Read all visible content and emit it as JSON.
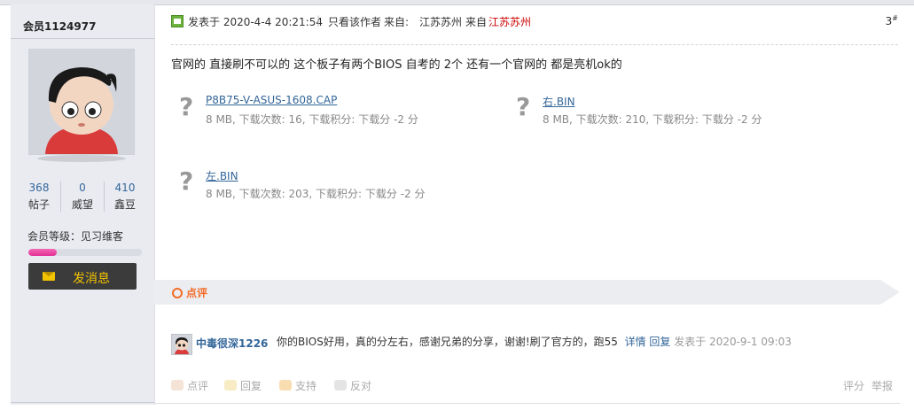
{
  "sidebar": {
    "username": "会员1124977",
    "stats": [
      {
        "value": "368",
        "label": "帖子"
      },
      {
        "value": "0",
        "label": "威望"
      },
      {
        "value": "410",
        "label": "鑫豆"
      }
    ],
    "level_label": "会员等级：见习维客",
    "level_progress_percent": 25,
    "message_button": "发消息"
  },
  "post": {
    "posted_label": "发表于 2020-4-4 20:21:54",
    "author_only": "只看该作者",
    "from_label": "来自:",
    "from_location": "江苏苏州",
    "from_label2": "来自",
    "from_location_red": "江苏苏州",
    "floor_number": "3",
    "floor_suffix": "#",
    "content": "官网的 直接刷不可以的 这个板子有两个BIOS 自考的 2个  还有一个官网的 都是亮机ok的",
    "attachments": [
      {
        "name": "P8B75-V-ASUS-1608.CAP",
        "meta": "8 MB, 下载次数: 16, 下载积分: 下载分 -2 分"
      },
      {
        "name": "右.BIN",
        "meta": "8 MB, 下载次数: 210, 下载积分: 下载分 -2 分"
      },
      {
        "name": "左.BIN",
        "meta": "8 MB, 下载次数: 203, 下载积分: 下载分 -2 分"
      }
    ]
  },
  "rating": {
    "title": "点评"
  },
  "comment": {
    "user": "中毒很深1226",
    "text": "你的BIOS好用，真的分左右，感谢兄弟的分享，谢谢!刷了官方的，跑55",
    "detail_link": "详情",
    "reply_link": "回复",
    "date": "发表于 2020-9-1 09:03"
  },
  "actions": {
    "comment": "点评",
    "reply": "回复",
    "support": "支持",
    "oppose": "反对",
    "rate": "评分",
    "report": "举报"
  },
  "colors": {
    "link": "#336699",
    "red": "#cc0000",
    "orange": "#f26c29",
    "sidebar_bg": "#e9ebf1"
  }
}
